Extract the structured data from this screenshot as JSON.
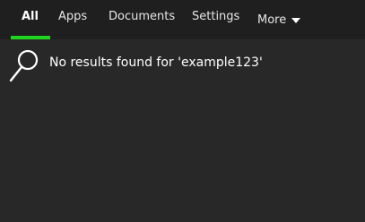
{
  "tabs": [
    {
      "label": "All",
      "active": true
    },
    {
      "label": "Apps",
      "active": false
    },
    {
      "label": "Documents",
      "active": false
    },
    {
      "label": "Settings",
      "active": false
    },
    {
      "label": "More",
      "active": false
    }
  ],
  "results": {
    "icon": "search-icon",
    "message": "No results found for 'example123'"
  },
  "colors": {
    "accent": "#1fd31f",
    "tabbar_bg": "#1f1f1f",
    "content_bg": "#282828",
    "text": "#ffffff"
  }
}
